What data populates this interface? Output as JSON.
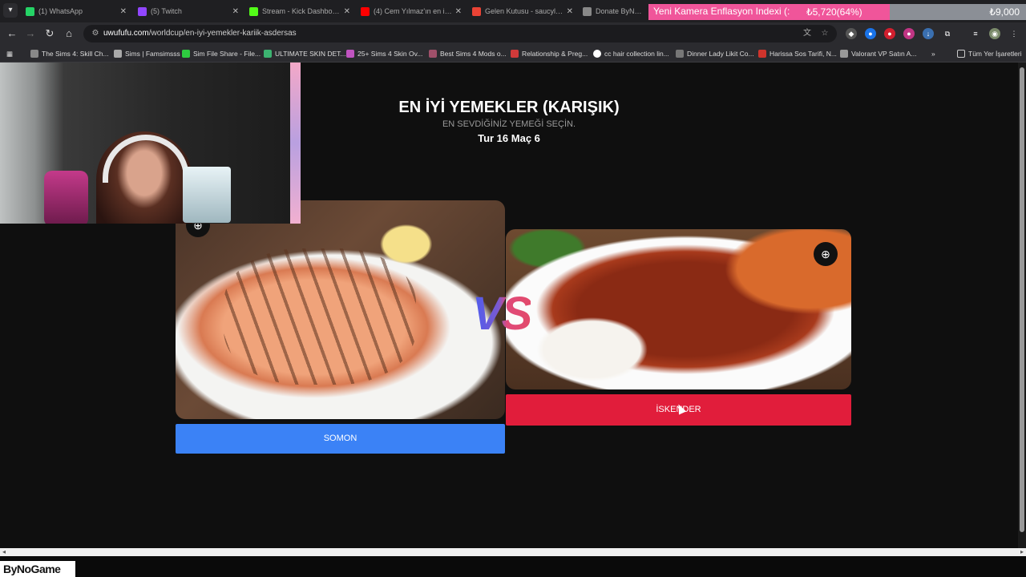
{
  "tabs": [
    {
      "title": "(1) WhatsApp",
      "color": "#25d366"
    },
    {
      "title": "(5) Twitch",
      "color": "#9146ff"
    },
    {
      "title": "Stream - Kick Dashboard",
      "color": "#53fc18"
    },
    {
      "title": "(4) Cem Yılmaz'ın en iyi ta",
      "color": "#ff0000"
    },
    {
      "title": "Gelen Kutusu - saucyluna",
      "color": "#ea4335"
    },
    {
      "title": "Donate ByNoGame",
      "color": "#888888"
    }
  ],
  "donation": {
    "label": "Yeni Kamera Enflasyon Indexi (:",
    "current": "₺5,720(64%)",
    "progress": 0.64,
    "goal": "₺9,000"
  },
  "address": {
    "domain": "uwufufu.com",
    "path": "/worldcup/en-iyi-yemekler-kariik-asdersas"
  },
  "bookmarks": [
    "The Sims 4: Skill Ch...",
    "Sims | Famsimsss",
    "Sim File Share - File...",
    "ULTIMATE SKIN DET...",
    "25+ Sims 4 Skin Ov...",
    "Best Sims 4 Mods o...",
    "Relationship & Preg...",
    "cc hair collection lin...",
    "Dinner Lady Likit Co...",
    "Harissa Sos Tarifi, N...",
    "Valorant VP Satın A..."
  ],
  "bookmarks_more": "»",
  "all_bookmarks": "Tüm Yer İşaretleri",
  "game": {
    "title": "EN İYİ YEMEKLER (KARIŞIK)",
    "subtitle": "EN SEVDİĞİNİZ YEMEĞİ SEÇİN.",
    "round": "Tur 16 Maç 6",
    "vs": "VS",
    "left_choice": "SOMON",
    "right_choice": "İSKENDER"
  },
  "overlay_brand": "ByNoGame",
  "colors": {
    "left_button": "#3b82f6",
    "right_button": "#e11d3b",
    "donation_fill": "#f0559a"
  }
}
